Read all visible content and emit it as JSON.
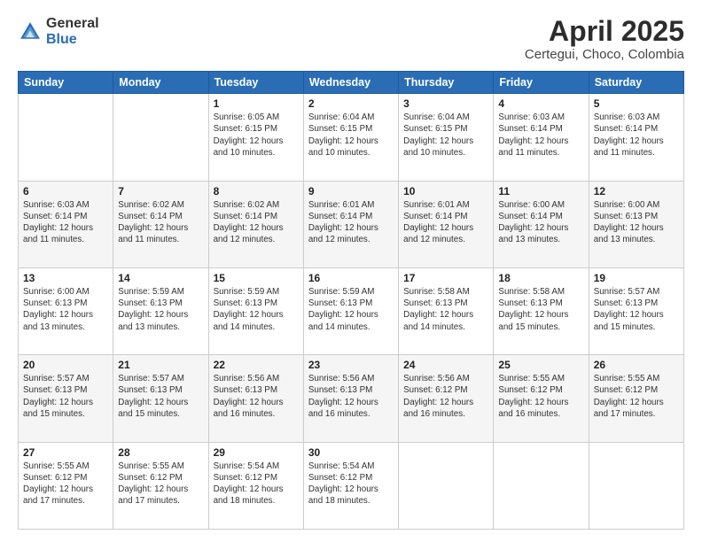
{
  "header": {
    "logo_general": "General",
    "logo_blue": "Blue",
    "title": "April 2025",
    "location": "Certegui, Choco, Colombia"
  },
  "days_of_week": [
    "Sunday",
    "Monday",
    "Tuesday",
    "Wednesday",
    "Thursday",
    "Friday",
    "Saturday"
  ],
  "weeks": [
    [
      {
        "day": "",
        "content": ""
      },
      {
        "day": "",
        "content": ""
      },
      {
        "day": "1",
        "content": "Sunrise: 6:05 AM\nSunset: 6:15 PM\nDaylight: 12 hours\nand 10 minutes."
      },
      {
        "day": "2",
        "content": "Sunrise: 6:04 AM\nSunset: 6:15 PM\nDaylight: 12 hours\nand 10 minutes."
      },
      {
        "day": "3",
        "content": "Sunrise: 6:04 AM\nSunset: 6:15 PM\nDaylight: 12 hours\nand 10 minutes."
      },
      {
        "day": "4",
        "content": "Sunrise: 6:03 AM\nSunset: 6:14 PM\nDaylight: 12 hours\nand 11 minutes."
      },
      {
        "day": "5",
        "content": "Sunrise: 6:03 AM\nSunset: 6:14 PM\nDaylight: 12 hours\nand 11 minutes."
      }
    ],
    [
      {
        "day": "6",
        "content": "Sunrise: 6:03 AM\nSunset: 6:14 PM\nDaylight: 12 hours\nand 11 minutes."
      },
      {
        "day": "7",
        "content": "Sunrise: 6:02 AM\nSunset: 6:14 PM\nDaylight: 12 hours\nand 11 minutes."
      },
      {
        "day": "8",
        "content": "Sunrise: 6:02 AM\nSunset: 6:14 PM\nDaylight: 12 hours\nand 12 minutes."
      },
      {
        "day": "9",
        "content": "Sunrise: 6:01 AM\nSunset: 6:14 PM\nDaylight: 12 hours\nand 12 minutes."
      },
      {
        "day": "10",
        "content": "Sunrise: 6:01 AM\nSunset: 6:14 PM\nDaylight: 12 hours\nand 12 minutes."
      },
      {
        "day": "11",
        "content": "Sunrise: 6:00 AM\nSunset: 6:14 PM\nDaylight: 12 hours\nand 13 minutes."
      },
      {
        "day": "12",
        "content": "Sunrise: 6:00 AM\nSunset: 6:13 PM\nDaylight: 12 hours\nand 13 minutes."
      }
    ],
    [
      {
        "day": "13",
        "content": "Sunrise: 6:00 AM\nSunset: 6:13 PM\nDaylight: 12 hours\nand 13 minutes."
      },
      {
        "day": "14",
        "content": "Sunrise: 5:59 AM\nSunset: 6:13 PM\nDaylight: 12 hours\nand 13 minutes."
      },
      {
        "day": "15",
        "content": "Sunrise: 5:59 AM\nSunset: 6:13 PM\nDaylight: 12 hours\nand 14 minutes."
      },
      {
        "day": "16",
        "content": "Sunrise: 5:59 AM\nSunset: 6:13 PM\nDaylight: 12 hours\nand 14 minutes."
      },
      {
        "day": "17",
        "content": "Sunrise: 5:58 AM\nSunset: 6:13 PM\nDaylight: 12 hours\nand 14 minutes."
      },
      {
        "day": "18",
        "content": "Sunrise: 5:58 AM\nSunset: 6:13 PM\nDaylight: 12 hours\nand 15 minutes."
      },
      {
        "day": "19",
        "content": "Sunrise: 5:57 AM\nSunset: 6:13 PM\nDaylight: 12 hours\nand 15 minutes."
      }
    ],
    [
      {
        "day": "20",
        "content": "Sunrise: 5:57 AM\nSunset: 6:13 PM\nDaylight: 12 hours\nand 15 minutes."
      },
      {
        "day": "21",
        "content": "Sunrise: 5:57 AM\nSunset: 6:13 PM\nDaylight: 12 hours\nand 15 minutes."
      },
      {
        "day": "22",
        "content": "Sunrise: 5:56 AM\nSunset: 6:13 PM\nDaylight: 12 hours\nand 16 minutes."
      },
      {
        "day": "23",
        "content": "Sunrise: 5:56 AM\nSunset: 6:13 PM\nDaylight: 12 hours\nand 16 minutes."
      },
      {
        "day": "24",
        "content": "Sunrise: 5:56 AM\nSunset: 6:12 PM\nDaylight: 12 hours\nand 16 minutes."
      },
      {
        "day": "25",
        "content": "Sunrise: 5:55 AM\nSunset: 6:12 PM\nDaylight: 12 hours\nand 16 minutes."
      },
      {
        "day": "26",
        "content": "Sunrise: 5:55 AM\nSunset: 6:12 PM\nDaylight: 12 hours\nand 17 minutes."
      }
    ],
    [
      {
        "day": "27",
        "content": "Sunrise: 5:55 AM\nSunset: 6:12 PM\nDaylight: 12 hours\nand 17 minutes."
      },
      {
        "day": "28",
        "content": "Sunrise: 5:55 AM\nSunset: 6:12 PM\nDaylight: 12 hours\nand 17 minutes."
      },
      {
        "day": "29",
        "content": "Sunrise: 5:54 AM\nSunset: 6:12 PM\nDaylight: 12 hours\nand 18 minutes."
      },
      {
        "day": "30",
        "content": "Sunrise: 5:54 AM\nSunset: 6:12 PM\nDaylight: 12 hours\nand 18 minutes."
      },
      {
        "day": "",
        "content": ""
      },
      {
        "day": "",
        "content": ""
      },
      {
        "day": "",
        "content": ""
      }
    ]
  ]
}
